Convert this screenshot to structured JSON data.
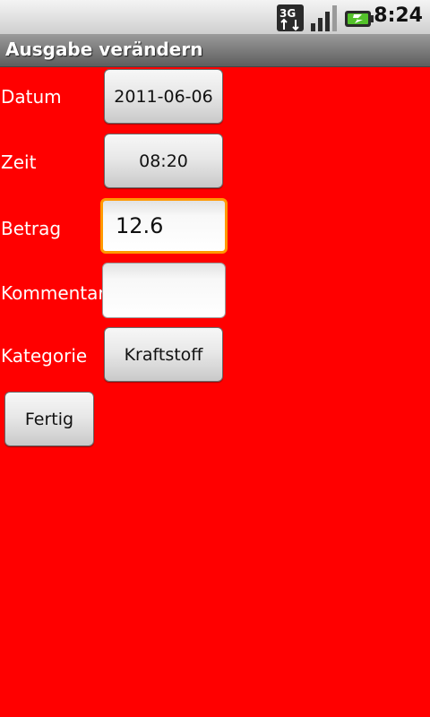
{
  "status_bar": {
    "network_icon": "3g-data-icon",
    "signal_icon": "signal-strength-icon",
    "battery_icon": "battery-charging-icon",
    "time": "8:24",
    "network_label": "3G"
  },
  "title_bar": {
    "title": "Ausgabe verändern"
  },
  "form": {
    "datum_label": "Datum",
    "datum_value": "2011-06-06",
    "zeit_label": "Zeit",
    "zeit_value": "08:20",
    "betrag_label": "Betrag",
    "betrag_value": "12.6",
    "kommentar_label": "Kommentar",
    "kommentar_value": "",
    "kategorie_label": "Kategorie",
    "kategorie_value": "Kraftstoff",
    "fertig_label": "Fertig"
  },
  "colors": {
    "background": "#ff0000",
    "focus_border": "#ff9900"
  }
}
